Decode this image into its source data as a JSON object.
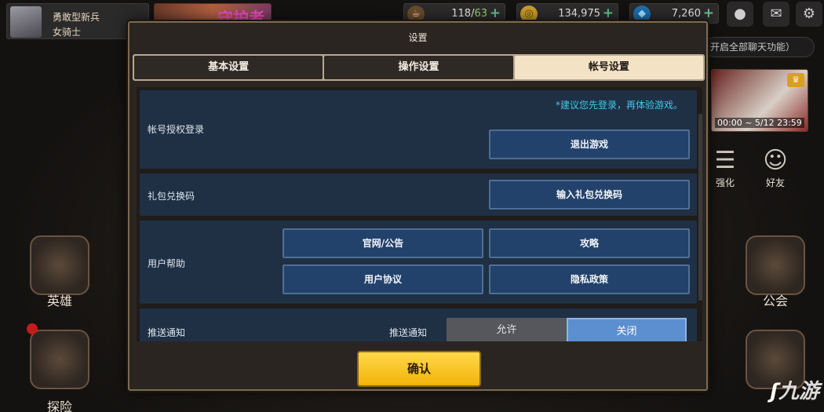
{
  "player": {
    "rank": "勇敢型新兵",
    "class": "女骑士"
  },
  "banner_text": "守护者",
  "resources": {
    "stamina": {
      "current": "118",
      "max": "63",
      "icon": "coffee-icon"
    },
    "gold": {
      "value": "134,975",
      "icon": "coin-icon"
    },
    "gems": {
      "value": "7,260",
      "icon": "gem-icon"
    }
  },
  "top_icons": [
    "chat-icon",
    "mail-icon",
    "settings-icon"
  ],
  "chat_tip": "开启全部聊天功能）",
  "event": {
    "time": "00:00 ~ 5/12 23:59"
  },
  "side_menu": {
    "enhance": "强化",
    "friends": "好友"
  },
  "emblems": {
    "hero": "英雄",
    "explore": "探险",
    "guild": "公会"
  },
  "watermark": "九游",
  "dialog": {
    "title": "设置",
    "tabs": [
      {
        "label": "基本设置",
        "active": false
      },
      {
        "label": "操作设置",
        "active": false
      },
      {
        "label": "帐号设置",
        "active": true
      }
    ],
    "account": {
      "label": "帐号授权登录",
      "hint": "*建议您先登录，再体验游戏。",
      "logout_button": "退出游戏"
    },
    "gift": {
      "label": "礼包兑换码",
      "button": "输入礼包兑换码"
    },
    "help": {
      "label": "用户帮助",
      "buttons": [
        "官网/公告",
        "攻略",
        "用户协议",
        "隐私政策"
      ]
    },
    "push": {
      "label": "推送通知",
      "sublabel": "推送通知",
      "options": [
        "允许",
        "关闭"
      ],
      "selected": "关闭"
    },
    "confirm_button": "确认"
  },
  "colors": {
    "accent_button": "#f5c21c",
    "active_tab": "#f3e2c4",
    "section_bg": "#1f3045",
    "hint_text": "#40c8e8"
  }
}
